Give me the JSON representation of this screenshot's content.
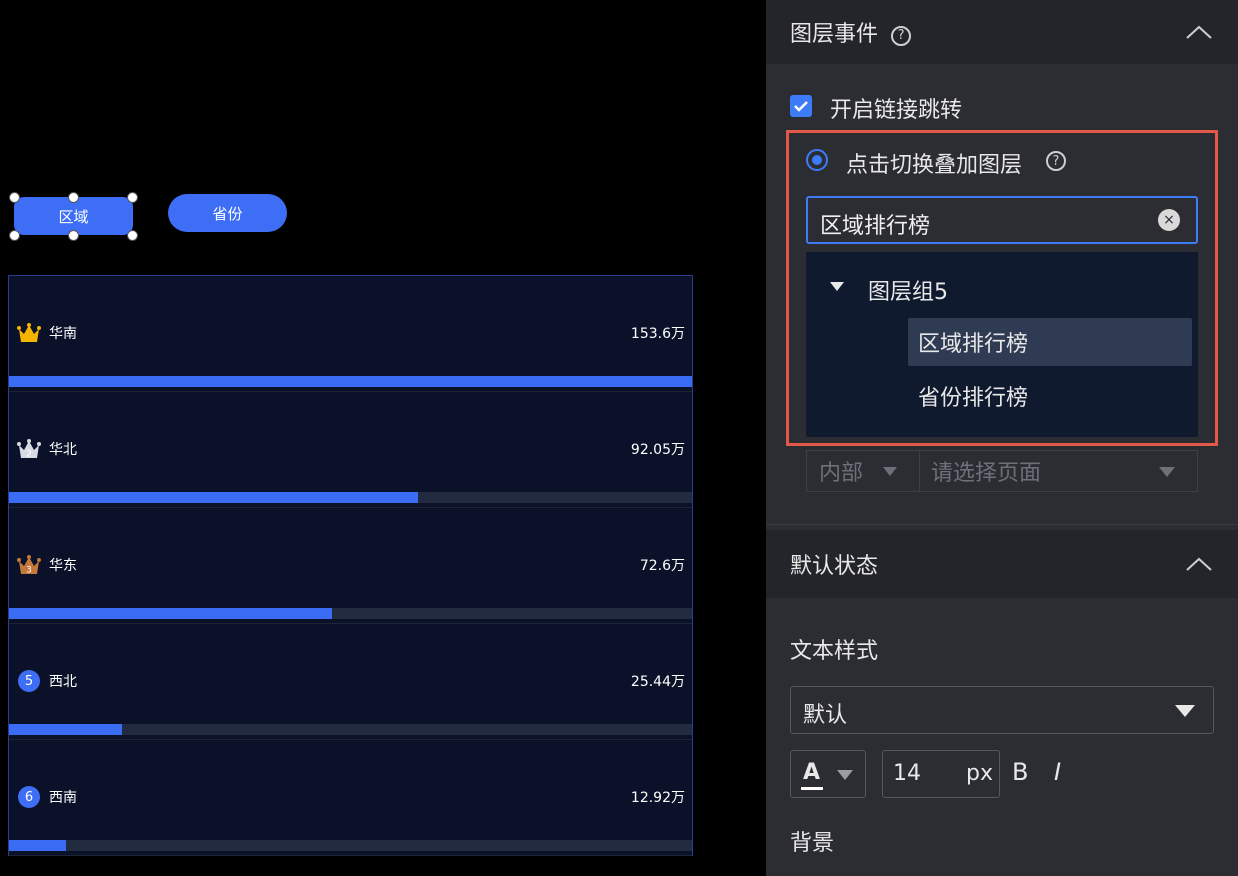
{
  "canvas": {
    "buttons": {
      "region": "区域",
      "province": "省份"
    },
    "ranking": [
      {
        "rank": "1",
        "badge": "gold-crown",
        "name": "华南",
        "value_label": "153.6万",
        "value": 153.6
      },
      {
        "rank": "2",
        "badge": "silver-crown",
        "name": "华北",
        "value_label": "92.05万",
        "value": 92.05
      },
      {
        "rank": "3",
        "badge": "bronze-crown",
        "name": "华东",
        "value_label": "72.6万",
        "value": 72.6
      },
      {
        "rank": "5",
        "badge": "circle",
        "name": "西北",
        "value_label": "25.44万",
        "value": 25.44
      },
      {
        "rank": "6",
        "badge": "circle",
        "name": "西南",
        "value_label": "12.92万",
        "value": 12.92
      }
    ],
    "max_value": 153.6,
    "colors": {
      "bar": "#3a6cf4",
      "gold": "#f4b400",
      "silver": "#d8dbe3",
      "bronze": "#c4793a"
    }
  },
  "panel": {
    "layer_events": {
      "title": "图层事件",
      "help_icon": "?",
      "enable_link": {
        "label": "开启链接跳转",
        "checked": true
      },
      "toggle_overlay": {
        "label": "点击切换叠加图层",
        "selected": true
      },
      "layer_input": {
        "value": "区域排行榜",
        "clear_icon": "×"
      },
      "dropdown": {
        "group": "图层组5",
        "items": [
          {
            "label": "区域排行榜",
            "selected": true
          },
          {
            "label": "省份排行榜",
            "selected": false
          }
        ]
      },
      "page_select": {
        "scope": "内部",
        "placeholder": "请选择页面"
      }
    },
    "default_state": {
      "title": "默认状态",
      "text_style_label": "文本样式",
      "font_value": "默认",
      "color_glyph": "A",
      "font_size": "14",
      "font_unit": "px",
      "bold": "B",
      "italic": "I",
      "background_label": "背景"
    },
    "colors": {
      "accent": "#3d7bf7",
      "highlight_border": "#e4584a"
    }
  }
}
